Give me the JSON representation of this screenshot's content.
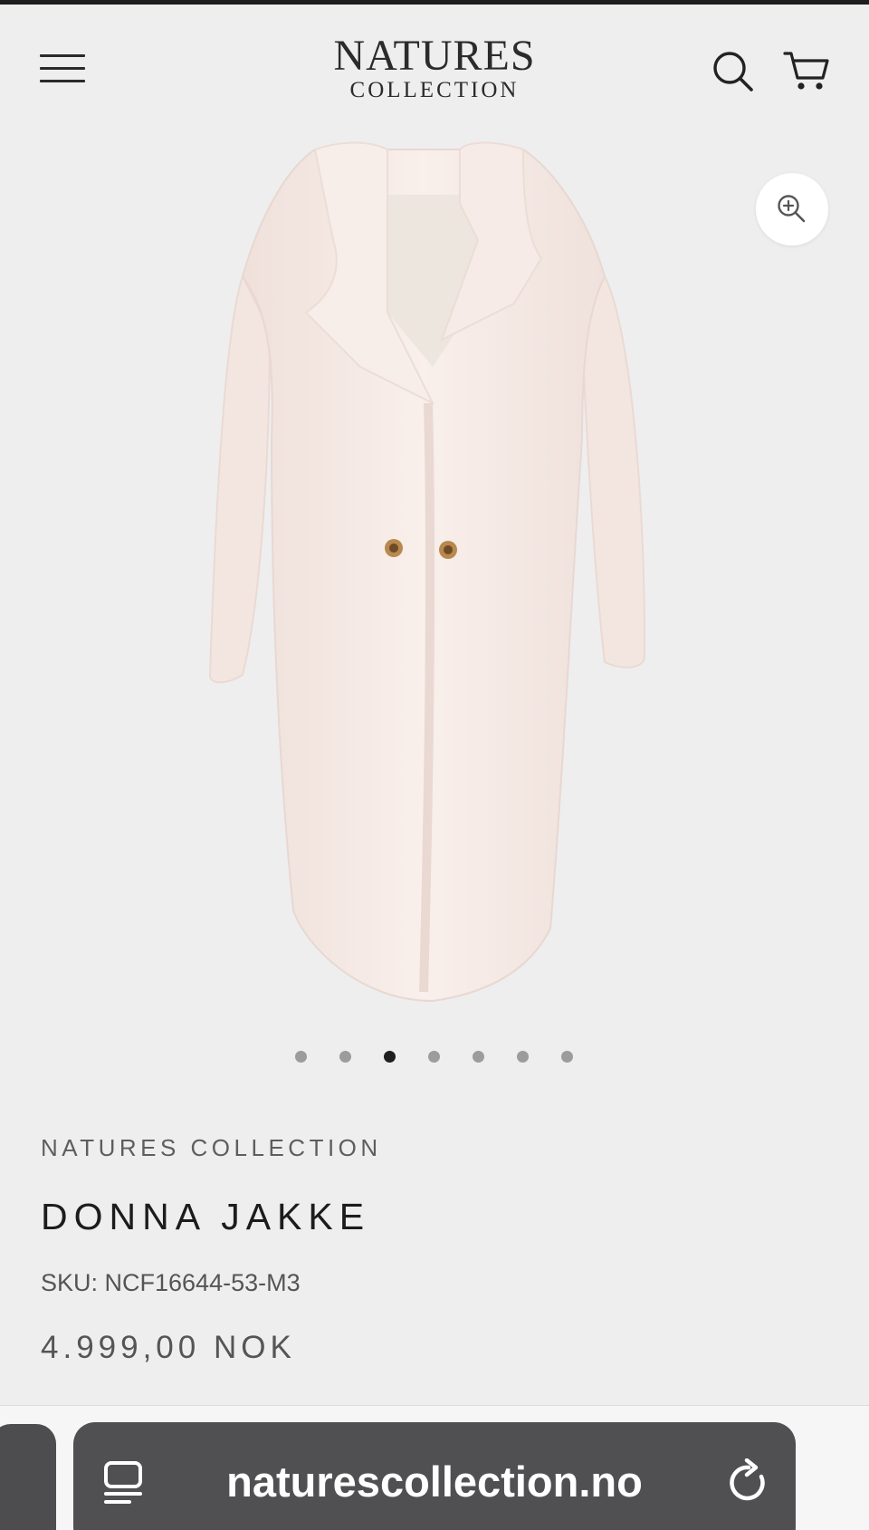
{
  "header": {
    "logo_line1": "NATURES",
    "logo_line2": "COLLECTION",
    "menu_icon": "hamburger-menu-icon",
    "search_icon": "search-icon",
    "cart_icon": "cart-icon"
  },
  "gallery": {
    "zoom_icon": "zoom-in-icon",
    "image_count": 7,
    "active_index": 2
  },
  "product": {
    "brand": "NATURES COLLECTION",
    "title": "DONNA JAKKE",
    "sku": "SKU: NCF16644-53-M3",
    "price": "4.999,00 NOK"
  },
  "browser": {
    "url": "naturescollection.no",
    "tab_icon": "tabs-icon",
    "reload_icon": "reload-icon"
  },
  "colors": {
    "background": "#eeeeef",
    "coat": "#f7ebe6",
    "text_dark": "#1c1c1c",
    "text_muted": "#5e5e5e",
    "url_bar": "#505052"
  }
}
